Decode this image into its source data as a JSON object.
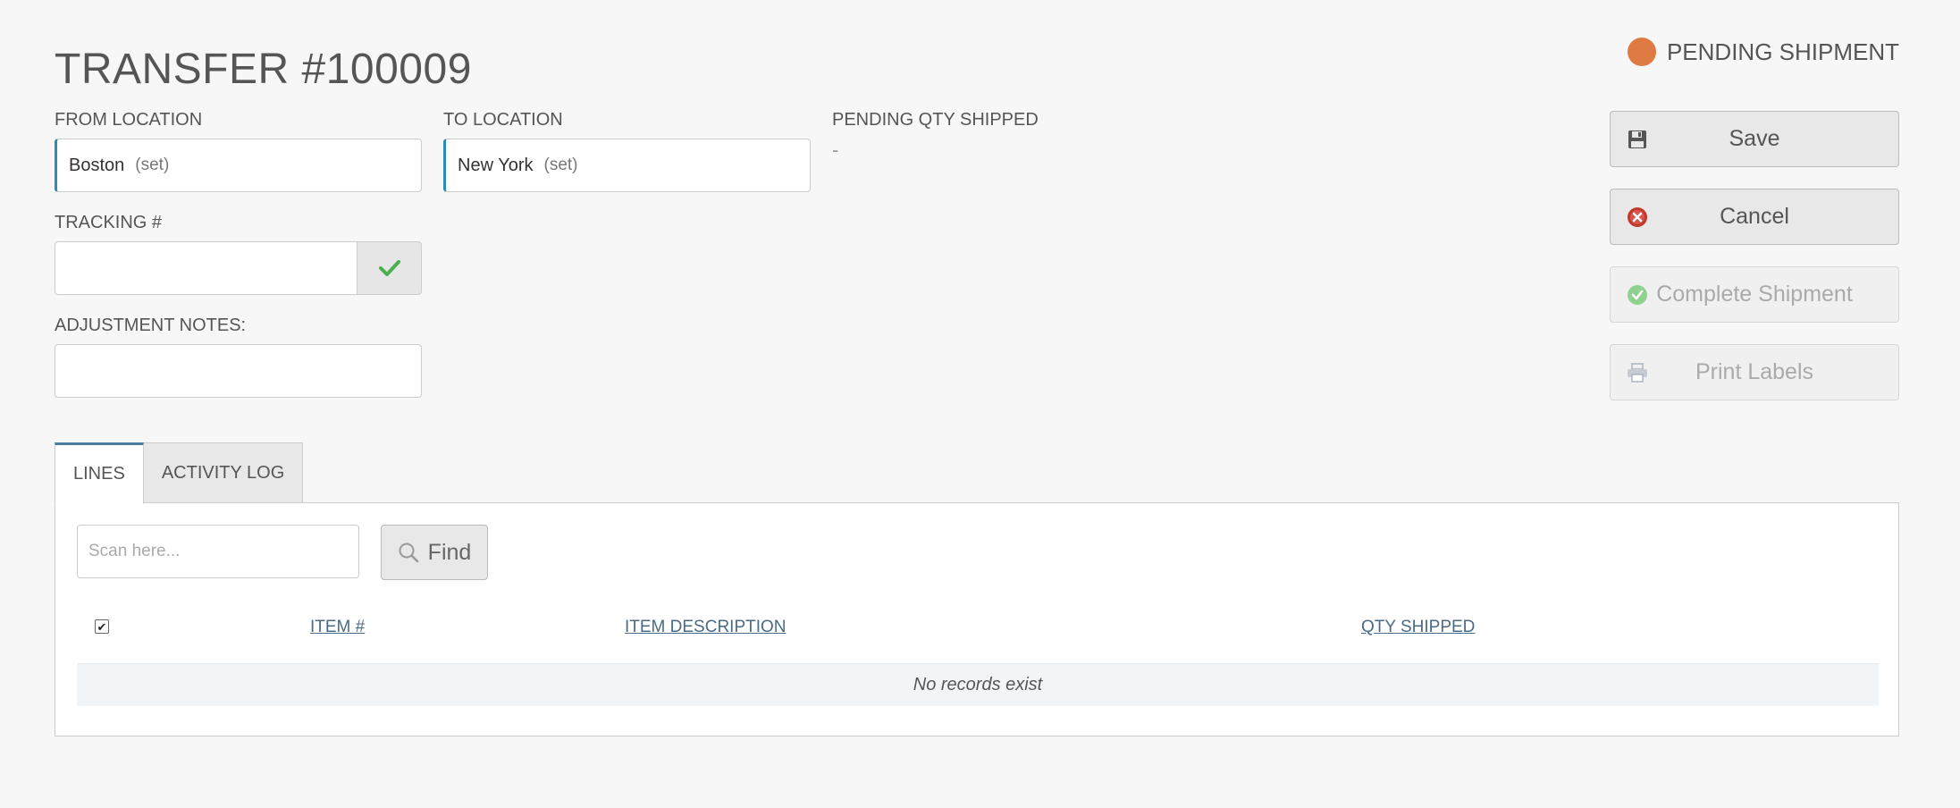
{
  "header": {
    "title": "TRANSFER #100009",
    "status": {
      "label": "PENDING SHIPMENT",
      "color": "#e07a45"
    }
  },
  "form": {
    "from_location": {
      "label": "FROM LOCATION",
      "value": "Boston",
      "set_label": "(set)"
    },
    "to_location": {
      "label": "TO LOCATION",
      "value": "New York",
      "set_label": "(set)"
    },
    "pending_qty": {
      "label": "PENDING QTY SHIPPED",
      "value": "-"
    },
    "tracking": {
      "label": "TRACKING #",
      "value": ""
    },
    "adjustment_notes": {
      "label": "ADJUSTMENT NOTES:",
      "value": ""
    }
  },
  "actions": {
    "save": "Save",
    "cancel": "Cancel",
    "complete_shipment": "Complete Shipment",
    "print_labels": "Print Labels"
  },
  "tabs": [
    {
      "label": "LINES",
      "active": true
    },
    {
      "label": "ACTIVITY LOG",
      "active": false
    }
  ],
  "lines": {
    "scan_placeholder": "Scan here...",
    "find_label": "Find",
    "columns": [
      "ITEM #",
      "ITEM DESCRIPTION",
      "QTY SHIPPED"
    ],
    "select_all_checked": true,
    "empty_message": "No records exist"
  },
  "colors": {
    "accent": "#2a8bb5",
    "status_pending": "#e07a45",
    "link": "#4a6b88"
  }
}
